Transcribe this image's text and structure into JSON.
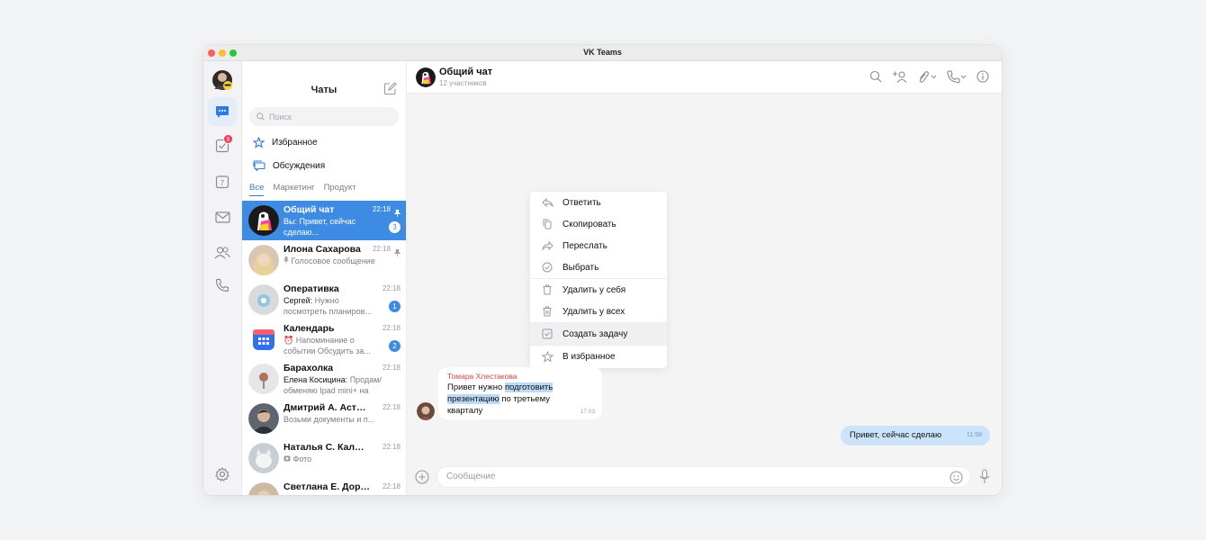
{
  "window": {
    "title": "VK Teams"
  },
  "chat_list": {
    "title": "Чаты",
    "search_placeholder": "Поиск",
    "special": [
      {
        "label": "Избранное",
        "icon": "star-icon"
      },
      {
        "label": "Обсуждения",
        "icon": "threads-icon"
      }
    ],
    "filters": [
      "Все",
      "Маркетинг",
      "Продукт"
    ],
    "items": [
      {
        "name": "Общий чат",
        "time": "22:18",
        "pinned": true,
        "sender": "Вы:",
        "text": "Привет, сейчас сделаю...",
        "count": "3"
      },
      {
        "name": "Илона Сахарова",
        "time": "22:18",
        "pinned": true,
        "sender": "",
        "text": "Голосовое сообщение",
        "count": ""
      },
      {
        "name": "Оперативка",
        "time": "22:18",
        "pinned": false,
        "sender": "Сергей:",
        "text": "Нужно посмотреть планиров...",
        "count": "1"
      },
      {
        "name": "Календарь",
        "time": "22:18",
        "pinned": false,
        "sender": "",
        "text": "⏰ Напоминание о событии Обсудить за...",
        "count": "2"
      },
      {
        "name": "Барахолка",
        "time": "22:18",
        "pinned": false,
        "sender": "Елена Косицина:",
        "text": "Продам/обменяю Ipad mini+ на ma...",
        "count": ""
      },
      {
        "name": "Дмитрий А. Астап...",
        "time": "22:18",
        "pinned": false,
        "sender": "",
        "text": "Возьми документы и п...",
        "count": ""
      },
      {
        "name": "Наталья С. Калли...",
        "time": "22:18",
        "pinned": false,
        "sender": "",
        "text": "Фото",
        "count": ""
      },
      {
        "name": "Светлана Е. Доро...",
        "time": "22:18",
        "pinned": false,
        "sender": "",
        "text": "",
        "count": ""
      }
    ]
  },
  "rail": {
    "tasks_badge": "8",
    "calendar_day": "7"
  },
  "chat": {
    "title": "Общий чат",
    "subtitle": "12 участников",
    "context_menu": [
      {
        "label": "Ответить",
        "icon": "reply-icon"
      },
      {
        "label": "Скопировать",
        "icon": "copy-icon"
      },
      {
        "label": "Переслать",
        "icon": "forward-icon"
      },
      {
        "label": "Выбрать",
        "icon": "select-icon"
      },
      {
        "label": "Удалить у себя",
        "icon": "trash-icon"
      },
      {
        "label": "Удалить у всех",
        "icon": "trash-all-icon"
      },
      {
        "label": "Создать задачу",
        "icon": "task-icon"
      },
      {
        "label": "В избранное",
        "icon": "star-icon"
      }
    ],
    "incoming": {
      "author": "Томара Хлестакова",
      "text_before": "Привет нужно ",
      "text_selected_1": "подготовить",
      "text_mid": " ",
      "text_selected_2": "презентацию",
      "text_after": " по третьему кварталу",
      "time": "17:03"
    },
    "outgoing": {
      "text": "Привет, сейчас сделаю",
      "time": "11:58"
    },
    "input_placeholder": "Сообщение"
  },
  "colors": {
    "accent": "#3d8be3",
    "author": "#e04343",
    "outgoing_bubble": "#cbe3fb",
    "badge": "#ff3347"
  }
}
